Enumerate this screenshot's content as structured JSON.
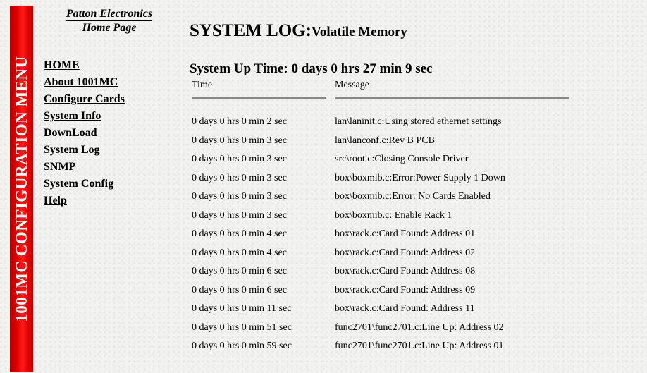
{
  "sidebar": {
    "banner": "1001MC CONFIGURATION MENU",
    "home_link": {
      "line1": "Patton Electronics",
      "line2": "Home Page"
    },
    "items": [
      {
        "label": "HOME"
      },
      {
        "label": "About 1001MC"
      },
      {
        "label": "Configure Cards"
      },
      {
        "label": "System Info"
      },
      {
        "label": "DownLoad"
      },
      {
        "label": "System Log"
      },
      {
        "label": "SNMP"
      },
      {
        "label": "System Config"
      },
      {
        "label": "Help"
      }
    ]
  },
  "main": {
    "title": "SYSTEM LOG:",
    "subtitle": "Volatile Memory",
    "uptime": "System Up Time: 0 days 0 hrs 27 min 9 sec",
    "columns": {
      "time": "Time",
      "message": "Message"
    },
    "rows": [
      {
        "time": "0 days 0 hrs 0 min 2 sec",
        "message": "lan\\laninit.c:Using stored ethernet settings"
      },
      {
        "time": "0 days 0 hrs 0 min 3 sec",
        "message": "lan\\lanconf.c:Rev B PCB"
      },
      {
        "time": "0 days 0 hrs 0 min 3 sec",
        "message": "src\\root.c:Closing Console Driver"
      },
      {
        "time": "0 days 0 hrs 0 min 3 sec",
        "message": "box\\boxmib.c:Error:Power Supply 1 Down"
      },
      {
        "time": "0 days 0 hrs 0 min 3 sec",
        "message": "box\\boxmib.c:Error: No Cards Enabled"
      },
      {
        "time": "0 days 0 hrs 0 min 3 sec",
        "message": "box\\boxmib.c: Enable Rack 1"
      },
      {
        "time": "0 days 0 hrs 0 min 4 sec",
        "message": "box\\rack.c:Card Found: Address 01"
      },
      {
        "time": "0 days 0 hrs 0 min 4 sec",
        "message": "box\\rack.c:Card Found: Address 02"
      },
      {
        "time": "0 days 0 hrs 0 min 6 sec",
        "message": "box\\rack.c:Card Found: Address 08"
      },
      {
        "time": "0 days 0 hrs 0 min 6 sec",
        "message": "box\\rack.c:Card Found: Address 09"
      },
      {
        "time": "0 days 0 hrs 0 min 11 sec",
        "message": "box\\rack.c:Card Found: Address 11"
      },
      {
        "time": "0 days 0 hrs 0 min 51 sec",
        "message": "func2701\\func2701.c:Line Up: Address 02"
      },
      {
        "time": "0 days 0 hrs 0 min 59 sec",
        "message": "func2701\\func2701.c:Line Up: Address 01"
      }
    ]
  }
}
